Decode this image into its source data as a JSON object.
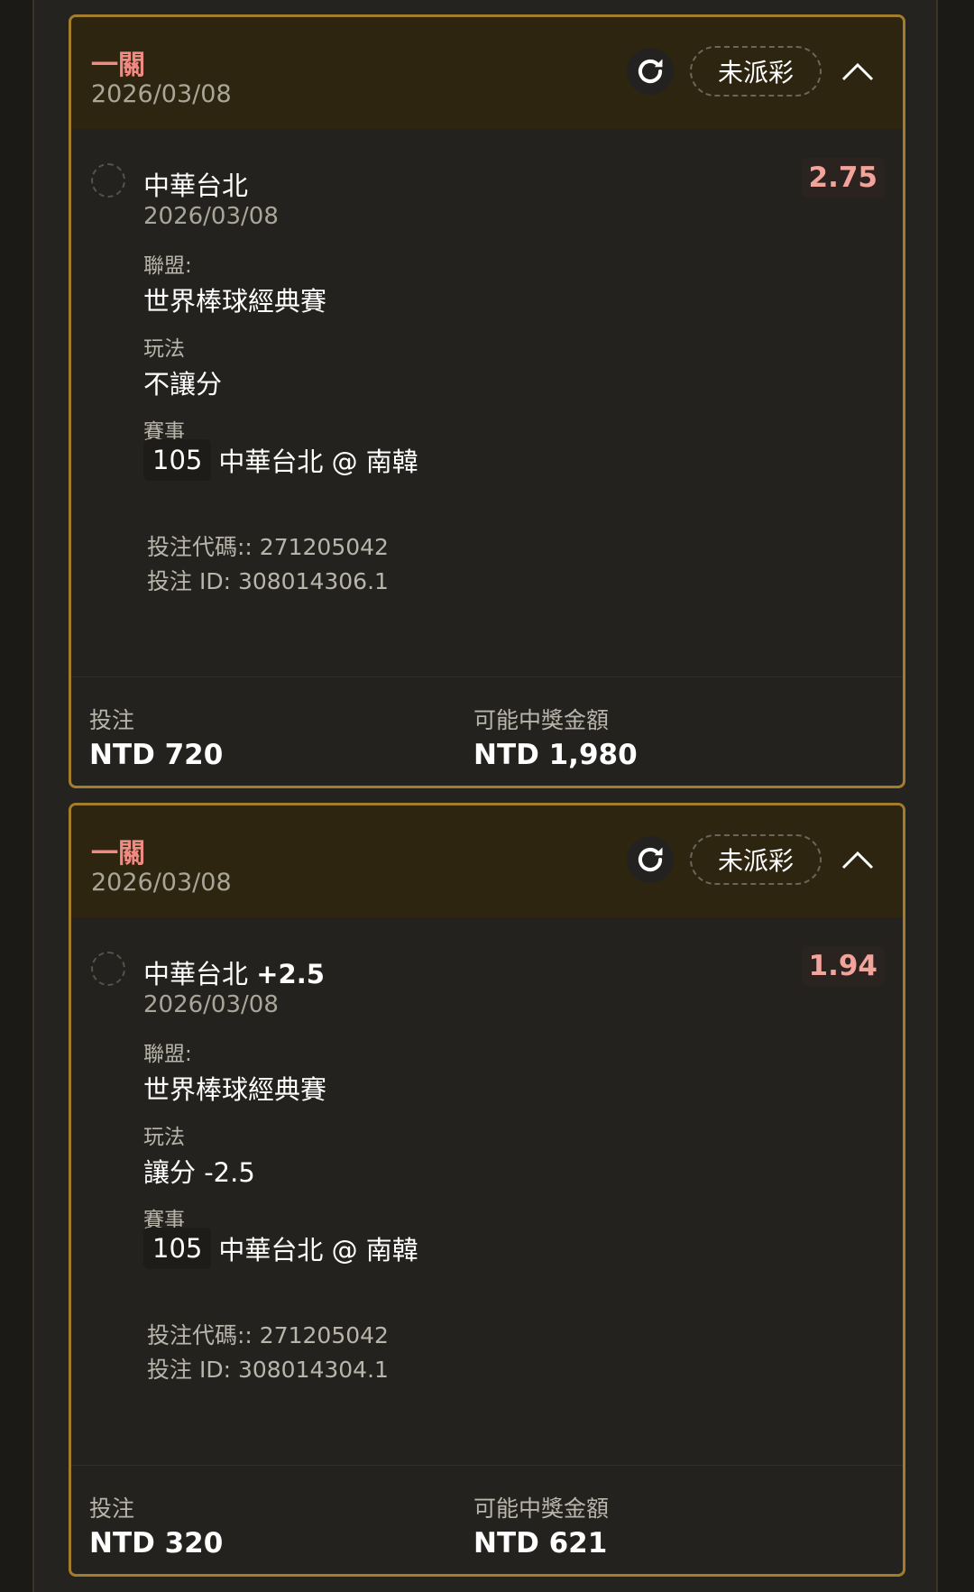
{
  "colors": {
    "accent_border": "#a47d2c",
    "header_bg": "#2d2510",
    "bet_type": "#ef8b83",
    "odds": "#f2a39a",
    "page_bg": "#24231f"
  },
  "icons": {
    "refresh": "refresh-icon",
    "collapse": "chevron-up-icon",
    "select": "dashed-circle-icon"
  },
  "bets": [
    {
      "type": "一關",
      "date": "2026/03/08",
      "status": "未派彩",
      "selection": {
        "team": "中華台北",
        "line": "",
        "date": "2026/03/08",
        "odds": "2.75"
      },
      "league_label": "聯盟:",
      "league": "世界棒球經典賽",
      "market_label": "玩法",
      "market": "不讓分",
      "event_label": "賽事",
      "event_number": "105",
      "event_name": "中華台北 @ 南韓",
      "bet_code": "投注代碼:: 271205042",
      "bet_id": "投注 ID: 308014306.1",
      "stake_label": "投注",
      "stake": "NTD 720",
      "payout_label": "可能中獎金額",
      "payout": "NTD 1,980"
    },
    {
      "type": "一關",
      "date": "2026/03/08",
      "status": "未派彩",
      "selection": {
        "team": "中華台北",
        "line": "+2.5",
        "date": "2026/03/08",
        "odds": "1.94"
      },
      "league_label": "聯盟:",
      "league": "世界棒球經典賽",
      "market_label": "玩法",
      "market": "讓分 -2.5",
      "event_label": "賽事",
      "event_number": "105",
      "event_name": "中華台北 @ 南韓",
      "bet_code": "投注代碼:: 271205042",
      "bet_id": "投注 ID: 308014304.1",
      "stake_label": "投注",
      "stake": "NTD 320",
      "payout_label": "可能中獎金額",
      "payout": "NTD 621"
    }
  ]
}
